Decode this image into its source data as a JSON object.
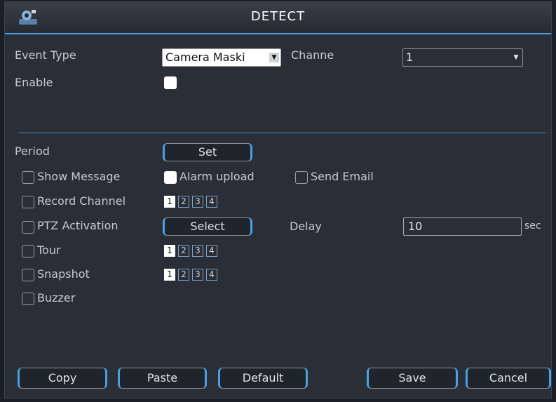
{
  "window": {
    "title": "DETECT"
  },
  "form": {
    "event_type_label": "Event Type",
    "event_type_value": "Camera Maski",
    "channel_label": "Channe",
    "channel_value": "1",
    "enable_label": "Enable",
    "enable_checked": false
  },
  "period": {
    "label": "Period",
    "set_button": "Set"
  },
  "options": {
    "show_message": "Show Message",
    "alarm_upload": "Alarm upload",
    "send_email": "Send Email",
    "record_channel": "Record Channel",
    "ptz_activation": "PTZ Activation",
    "select_button": "Select",
    "delay_label": "Delay",
    "delay_value": "10",
    "delay_unit": "sec",
    "tour": "Tour",
    "snapshot": "Snapshot",
    "buzzer": "Buzzer"
  },
  "record_channels": [
    {
      "label": "1",
      "selected": true
    },
    {
      "label": "2",
      "selected": false
    },
    {
      "label": "3",
      "selected": false
    },
    {
      "label": "4",
      "selected": false
    }
  ],
  "tour_channels": [
    {
      "label": "1",
      "selected": true
    },
    {
      "label": "2",
      "selected": false
    },
    {
      "label": "3",
      "selected": false
    },
    {
      "label": "4",
      "selected": false
    }
  ],
  "snapshot_channels": [
    {
      "label": "1",
      "selected": true
    },
    {
      "label": "2",
      "selected": false
    },
    {
      "label": "3",
      "selected": false
    },
    {
      "label": "4",
      "selected": false
    }
  ],
  "footer": {
    "copy": "Copy",
    "paste": "Paste",
    "default": "Default",
    "save": "Save",
    "cancel": "Cancel"
  },
  "icons": {
    "window_logo": "camera-logo-icon",
    "dropdown": "chevron-down-icon"
  },
  "colors": {
    "accent": "#4aa0e0",
    "background": "#2a2e36"
  }
}
